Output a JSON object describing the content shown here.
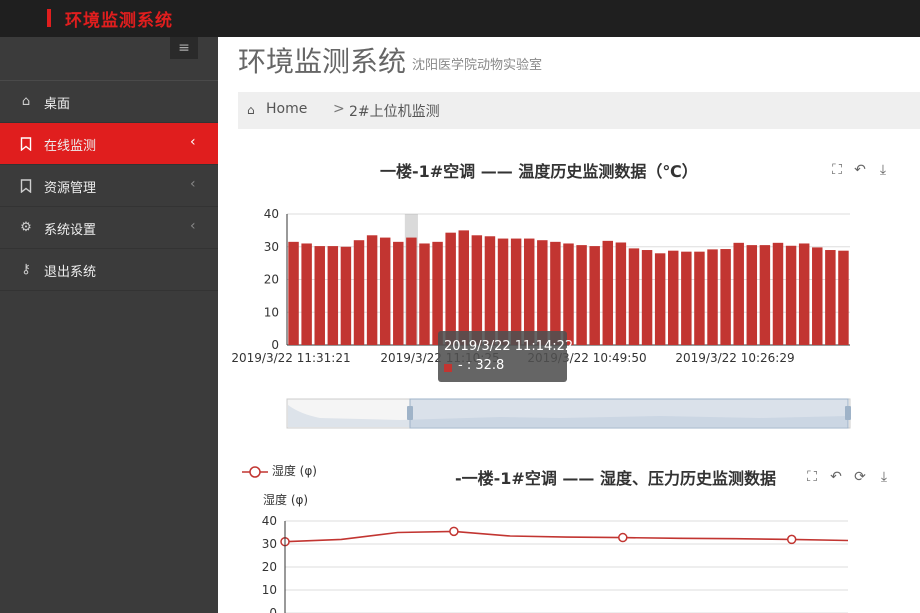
{
  "app": {
    "brand_title": "环境监测系统"
  },
  "sidebar": {
    "items": [
      {
        "label": "桌面",
        "icon": "home-icon",
        "active": false,
        "has_chevron": false
      },
      {
        "label": "在线监测",
        "icon": "bookmark-icon",
        "active": true,
        "has_chevron": true
      },
      {
        "label": "资源管理",
        "icon": "bookmark-icon",
        "active": false,
        "has_chevron": true
      },
      {
        "label": "系统设置",
        "icon": "gears-icon",
        "active": false,
        "has_chevron": true
      },
      {
        "label": "退出系统",
        "icon": "key-icon",
        "active": false,
        "has_chevron": false
      }
    ]
  },
  "header": {
    "title": "环境监测系统",
    "subtitle": "沈阳医学院动物实验室"
  },
  "breadcrumb": {
    "home": "Home",
    "separator": ">",
    "current": "2#上位机监测"
  },
  "colors": {
    "accent": "#e01e1e",
    "bar": "#c23531",
    "sidebar_bg": "#3b3b3b",
    "topbar_bg": "#1f1f1f"
  },
  "tooltip": {
    "time": "2019/3/22 11:14:22",
    "value_label": "- : 32.8"
  },
  "chart_data": [
    {
      "type": "bar",
      "title": "一楼-1#空调 —— 温度历史监测数据（℃）",
      "ylim": [
        0,
        40
      ],
      "yticks": [
        0,
        10,
        20,
        30,
        40
      ],
      "x_tick_labels": [
        "2019/3/22 11:31:21",
        "2019/3/22 11:10:25",
        "2019/3/22 10:49:50",
        "2019/3/22 10:26:29"
      ],
      "values": [
        31.5,
        31,
        30.2,
        30.2,
        30,
        32,
        33.5,
        32.8,
        31.5,
        32.8,
        31,
        31.5,
        34.3,
        35,
        33.5,
        33.2,
        32.5,
        32.5,
        32.5,
        32,
        31.5,
        31,
        30.5,
        30.2,
        31.8,
        31.3,
        29.5,
        29,
        28,
        28.8,
        28.5,
        28.5,
        29.2,
        29.3,
        31.2,
        30.5,
        30.5,
        31.2,
        30.3,
        31,
        29.8,
        29,
        28.8
      ],
      "highlight_index": 9,
      "grid": true
    },
    {
      "type": "line",
      "title": "-一楼-1#空调 —— 湿度、压力历史监测数据",
      "ylabel": "湿度 (φ)",
      "ylim": [
        0,
        40
      ],
      "yticks": [
        0,
        10,
        20,
        30,
        40
      ],
      "series": [
        {
          "name": "湿度 (φ)",
          "values": [
            31,
            32,
            35,
            35.5,
            33.5,
            33,
            32.8,
            32.5,
            32.3,
            32,
            31.5
          ]
        }
      ],
      "marker_indices": [
        0,
        3,
        6,
        9
      ],
      "grid": true
    }
  ]
}
